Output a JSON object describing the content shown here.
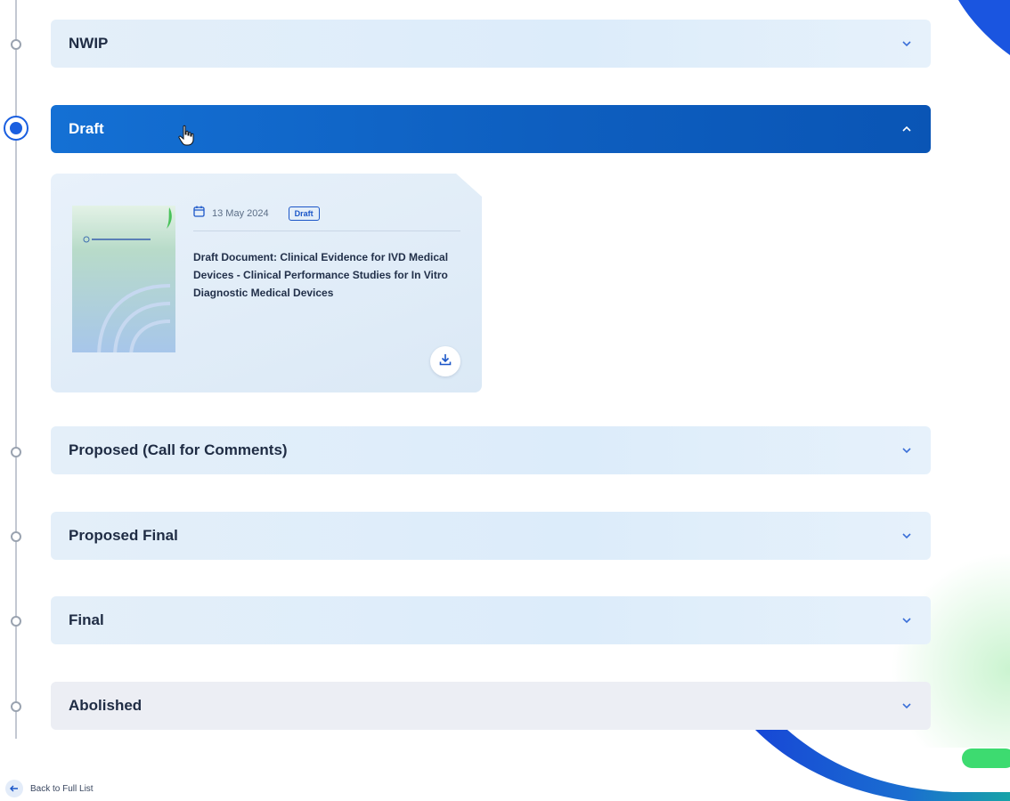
{
  "stages": [
    {
      "label": "NWIP",
      "expanded": false
    },
    {
      "label": "Draft",
      "expanded": true
    },
    {
      "label": "Proposed (Call for Comments)",
      "expanded": false
    },
    {
      "label": "Proposed Final",
      "expanded": false
    },
    {
      "label": "Final",
      "expanded": false
    },
    {
      "label": "Abolished",
      "expanded": false
    }
  ],
  "document": {
    "date": "13 May 2024",
    "badge": "Draft",
    "title": "Draft Document: Clinical Evidence for IVD Medical Devices - Clinical Performance Studies for In Vitro Diagnostic Medical Devices"
  },
  "back_link": {
    "label": "Back to Full List"
  },
  "icons": {
    "expand": "chevron-down-icon",
    "collapse": "chevron-up-icon",
    "calendar": "calendar-icon",
    "download": "download-icon",
    "back": "arrow-left-icon"
  },
  "colors": {
    "active_header": "#1470d4",
    "row_background": "#dcecfa",
    "badge_blue": "#1b56c8",
    "accent_green": "#3ddb70",
    "timeline_active": "#1a5fe0"
  }
}
